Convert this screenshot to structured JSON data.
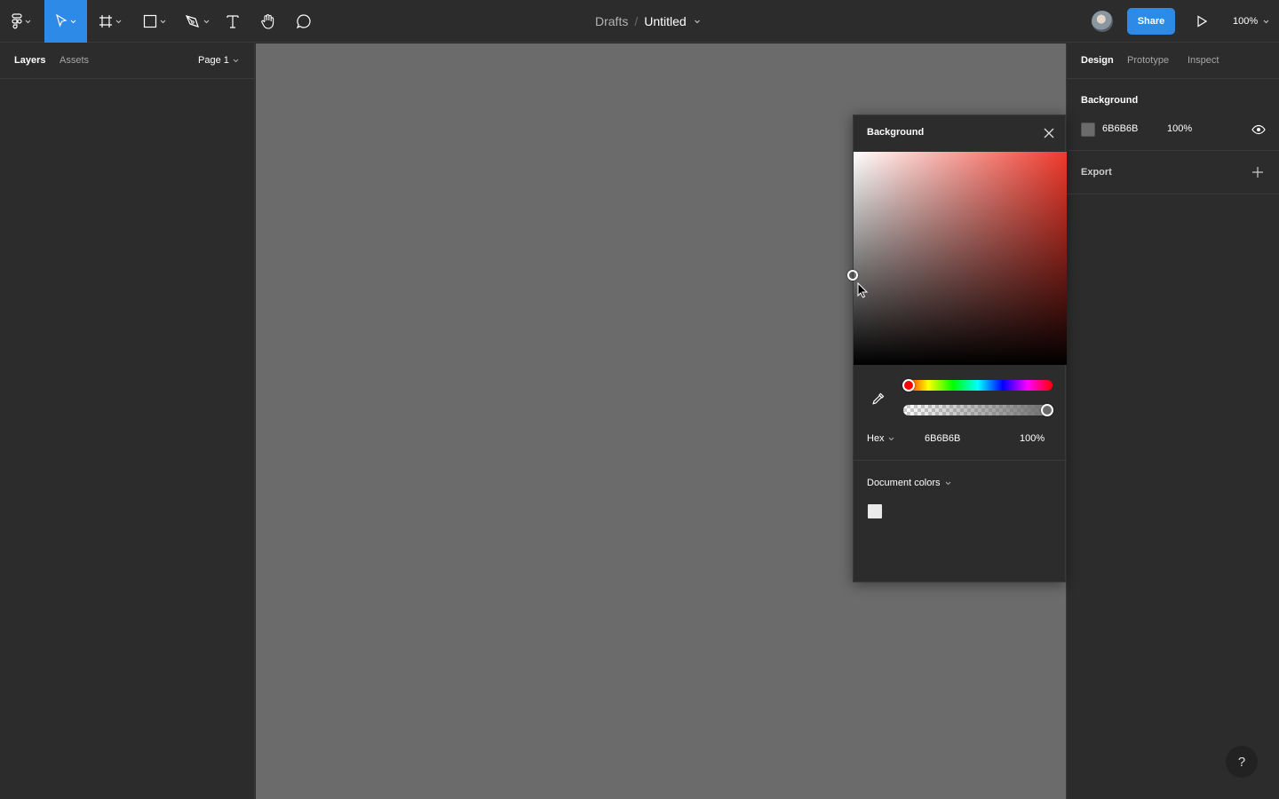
{
  "toolbar": {
    "tools": [
      "main-menu",
      "move",
      "frame",
      "rectangle",
      "pen",
      "text",
      "hand",
      "comment"
    ],
    "active_tool": "move",
    "breadcrumb_parent": "Drafts",
    "breadcrumb_sep": "/",
    "file_name": "Untitled",
    "share_label": "Share",
    "zoom_label": "100%"
  },
  "left_panel": {
    "tabs": [
      {
        "label": "Layers",
        "active": true
      },
      {
        "label": "Assets",
        "active": false
      }
    ],
    "page_label": "Page 1"
  },
  "right_panel": {
    "tabs": [
      {
        "label": "Design",
        "active": true
      },
      {
        "label": "Prototype",
        "active": false
      },
      {
        "label": "Inspect",
        "active": false
      }
    ],
    "background": {
      "title": "Background",
      "hex": "6B6B6B",
      "opacity": "100%"
    },
    "export": {
      "title": "Export"
    }
  },
  "color_picker": {
    "title": "Background",
    "hex_mode": "Hex",
    "hex": "6B6B6B",
    "opacity": "100%",
    "hue_level": 0,
    "alpha_level": 1,
    "doc_colors_label": "Document colors",
    "doc_colors": [
      "#e9e9e9"
    ]
  },
  "help_label": "?",
  "colors": {
    "accent": "#2d8ae6",
    "canvas": "#6b6b6b",
    "panel": "#2c2c2c"
  }
}
